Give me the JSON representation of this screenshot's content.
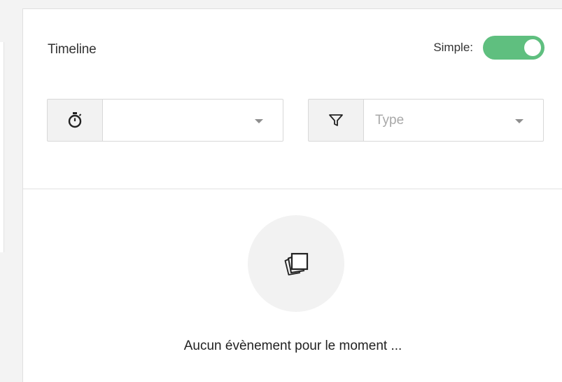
{
  "timeline": {
    "title": "Timeline",
    "simple_label": "Simple:",
    "simple_enabled": true
  },
  "filters": {
    "time_icon": "stopwatch-icon",
    "time_select_value": "",
    "type_icon": "filter-funnel-icon",
    "type_placeholder": "Type"
  },
  "empty_state": {
    "icon": "photo-stack-icon",
    "message": "Aucun évènement pour le moment ..."
  },
  "colors": {
    "toggle_on": "#5fbf7f",
    "addon_bg": "#f2f2f2",
    "page_bg": "#f3f3f3"
  }
}
